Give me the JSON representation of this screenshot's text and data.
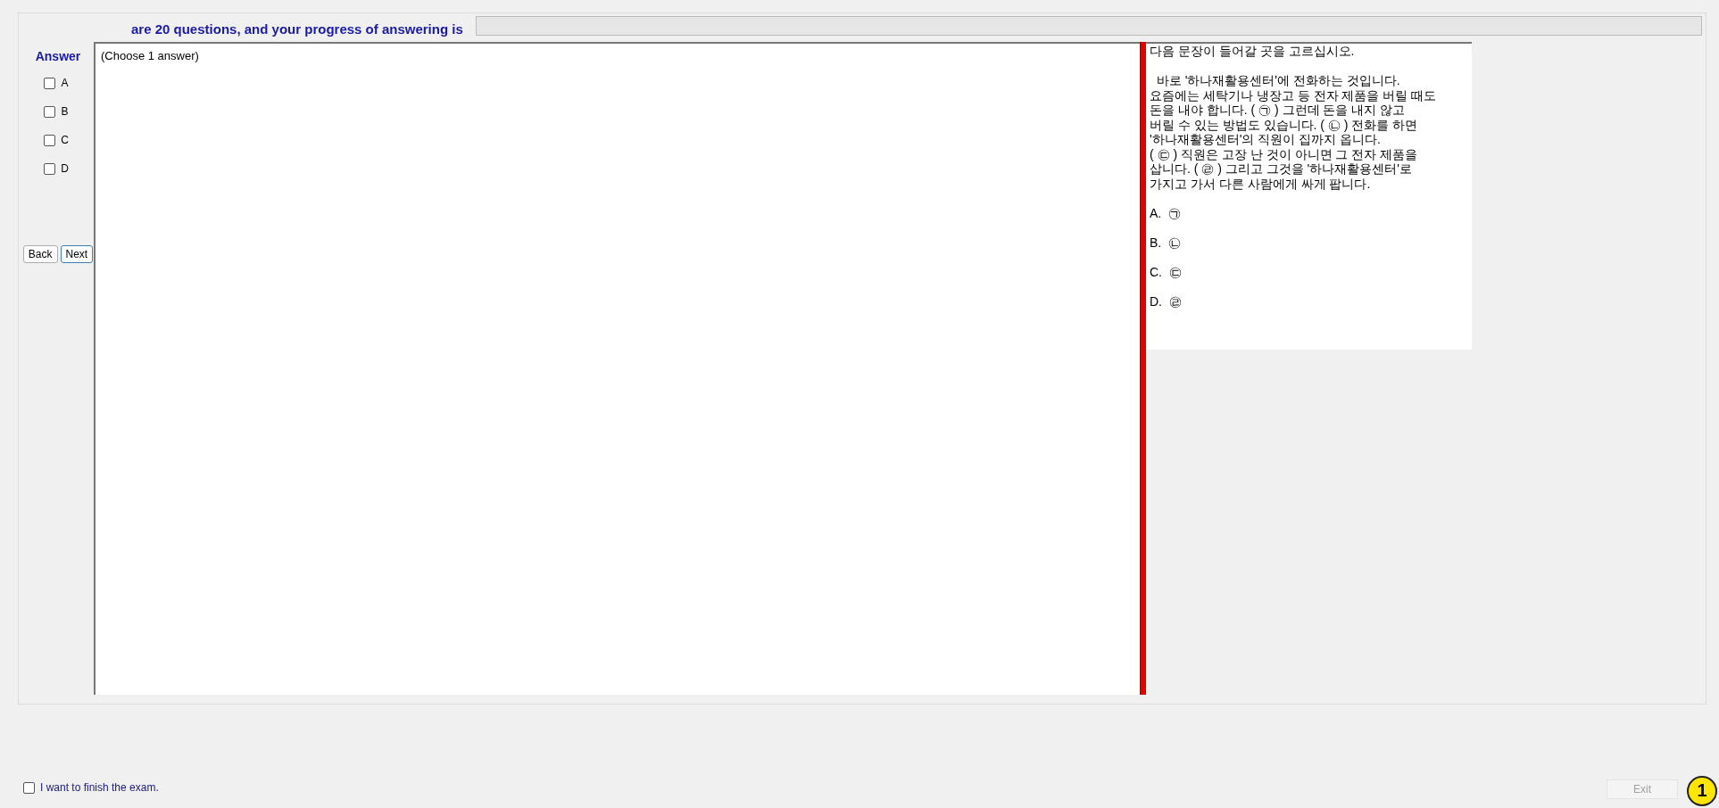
{
  "header": {
    "text": "are 20 questions, and your progress of answering is",
    "progress": {
      "level": 0
    }
  },
  "answer_panel": {
    "title": "Answer",
    "options": [
      {
        "label": "A",
        "checked": false
      },
      {
        "label": "B",
        "checked": false
      },
      {
        "label": "C",
        "checked": false
      },
      {
        "label": "D",
        "checked": false
      }
    ],
    "buttons": [
      {
        "label": "Back",
        "focused": false
      },
      {
        "label": "Next",
        "focused": true
      }
    ]
  },
  "question": {
    "instruction": "(Choose 1 answer)"
  },
  "passage": {
    "heading": "다음 문장이 들어갈 곳을 고르십시오.",
    "lines": [
      "  바로 '하나재활용센터'에 전화하는 것입니다.",
      "요즘에는 세탁기나 냉장고 등 전자 제품을 버릴 때도",
      "돈을 내야 합니다. ( ㉠ ) 그런데 돈을 내지 않고",
      "버릴 수 있는 방법도 있습니다. ( ㉡ ) 전화를 하면",
      "'하나재활용센터'의 직원이 집까지 옵니다.",
      "( ㉢ ) 직원은 고장 난 것이 아니면 그 전자 제품을",
      "삽니다. ( ㉣ ) 그리고 그것을 '하나재활용센터'로",
      "가지고 가서 다른 사람에게 싸게 팝니다."
    ],
    "choices": [
      "A.  ㉠",
      "B.  ㉡",
      "C.  ㉢",
      "D.  ㉣"
    ]
  },
  "finish": {
    "label": "I want to finish the exam.",
    "checked": false
  },
  "exit_button": {
    "label": "Exit",
    "disabled": true
  },
  "marker": "1"
}
